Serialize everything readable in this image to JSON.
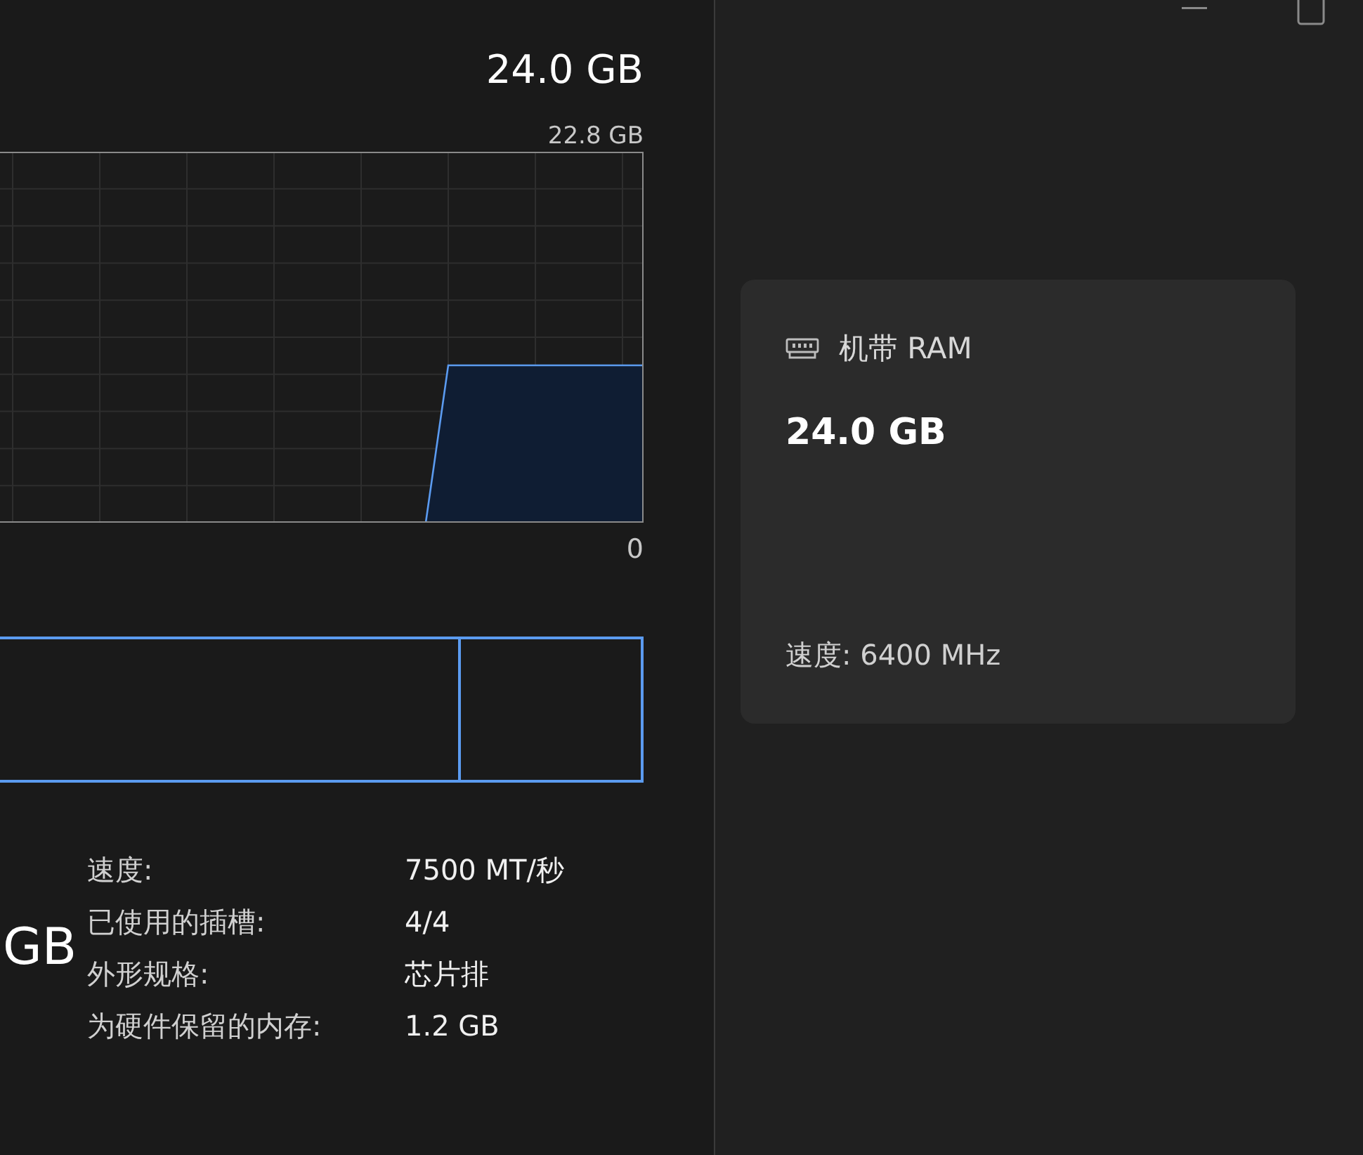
{
  "memory_panel": {
    "total": "24.0 GB",
    "chart_max_label": "22.8 GB",
    "chart_min_label": "0",
    "big_value": "GB",
    "stats": [
      {
        "label": "速度:",
        "value": "7500 MT/秒"
      },
      {
        "label": "已使用的插槽:",
        "value": "4/4"
      },
      {
        "label": "外形规格:",
        "value": "芯片排"
      },
      {
        "label": "为硬件保留的内存:",
        "value": "1.2 GB"
      }
    ]
  },
  "ram_card": {
    "title": "机带 RAM",
    "value": "24.0 GB",
    "speed": "速度: 6400 MHz"
  }
}
